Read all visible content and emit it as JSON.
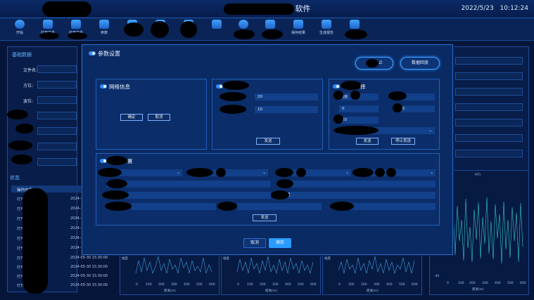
{
  "app": {
    "title_suffix": "软件",
    "date": "2022/5/23",
    "time": "10:12:24"
  },
  "toolbar": {
    "items": [
      {
        "label": "开始",
        "icon": "play-icon"
      },
      {
        "label": "打开文件",
        "icon": "folder-icon"
      },
      {
        "label": "打开文件",
        "icon": "folder-icon"
      },
      {
        "label": "参数",
        "icon": "sliders-icon"
      },
      {
        "label": "",
        "icon": "tool-icon"
      },
      {
        "label": "",
        "icon": "tool-icon"
      },
      {
        "label": "",
        "icon": "tool-icon"
      },
      {
        "label": "",
        "icon": "cube-icon"
      },
      {
        "label": "",
        "icon": "network-icon"
      },
      {
        "label": "",
        "icon": "image-icon"
      },
      {
        "label": "保存结果",
        "icon": "save-icon"
      },
      {
        "label": "生成报告",
        "icon": "report-icon"
      },
      {
        "label": "",
        "icon": "export-icon"
      }
    ]
  },
  "left_panel": {
    "header": "基础数据",
    "fields": [
      {
        "label": "文件名:",
        "value": ""
      },
      {
        "label": "方位:",
        "value": ""
      },
      {
        "label": "波位:",
        "value": ""
      }
    ],
    "state_header": "状态",
    "log_header": "操作内容",
    "logs": [
      {
        "op": "打开",
        "time": "2024-05"
      },
      {
        "op": "打开",
        "time": "2024-05"
      },
      {
        "op": "打开",
        "time": "2024-05"
      },
      {
        "op": "打开",
        "time": "2024-05"
      },
      {
        "op": "打开",
        "time": "2024-05"
      },
      {
        "op": "打开",
        "time": "2024-05"
      },
      {
        "op": "打开",
        "time": "2024-05-30  15:30:00"
      },
      {
        "op": "打开",
        "time": "2024-05-30  15:30:00"
      },
      {
        "op": "打开",
        "time": "2024-05-30  15:30:00"
      },
      {
        "op": "打开",
        "time": "2024-05-30  15:30:00"
      }
    ]
  },
  "charts": {
    "xlabel": "距离(m)",
    "ylabel": "幅度",
    "xticks": [
      "0",
      "100",
      "200",
      "300",
      "400",
      "500",
      "600"
    ],
    "right_title": "MTI",
    "right_yticks": [
      "20",
      "0",
      "-20",
      "-40"
    ]
  },
  "modal": {
    "title": "参数设置",
    "stop_label": "止",
    "playback_label": "数据回放",
    "network": {
      "title": "网络信息",
      "ok": "确定",
      "cancel": "取消"
    },
    "panel2": {
      "v1": "20",
      "v2": "10",
      "send": "发送"
    },
    "panel3": {
      "title_tail": "择",
      "tiny": "设置",
      "v1": "20",
      "v2": "0",
      "v3": "20",
      "send": "发送",
      "stop_send": "停止发送"
    },
    "panel4": {
      "title_tail": "置",
      "field_text": "置",
      "send": "发送"
    },
    "cancel": "取消",
    "save": "保存"
  }
}
